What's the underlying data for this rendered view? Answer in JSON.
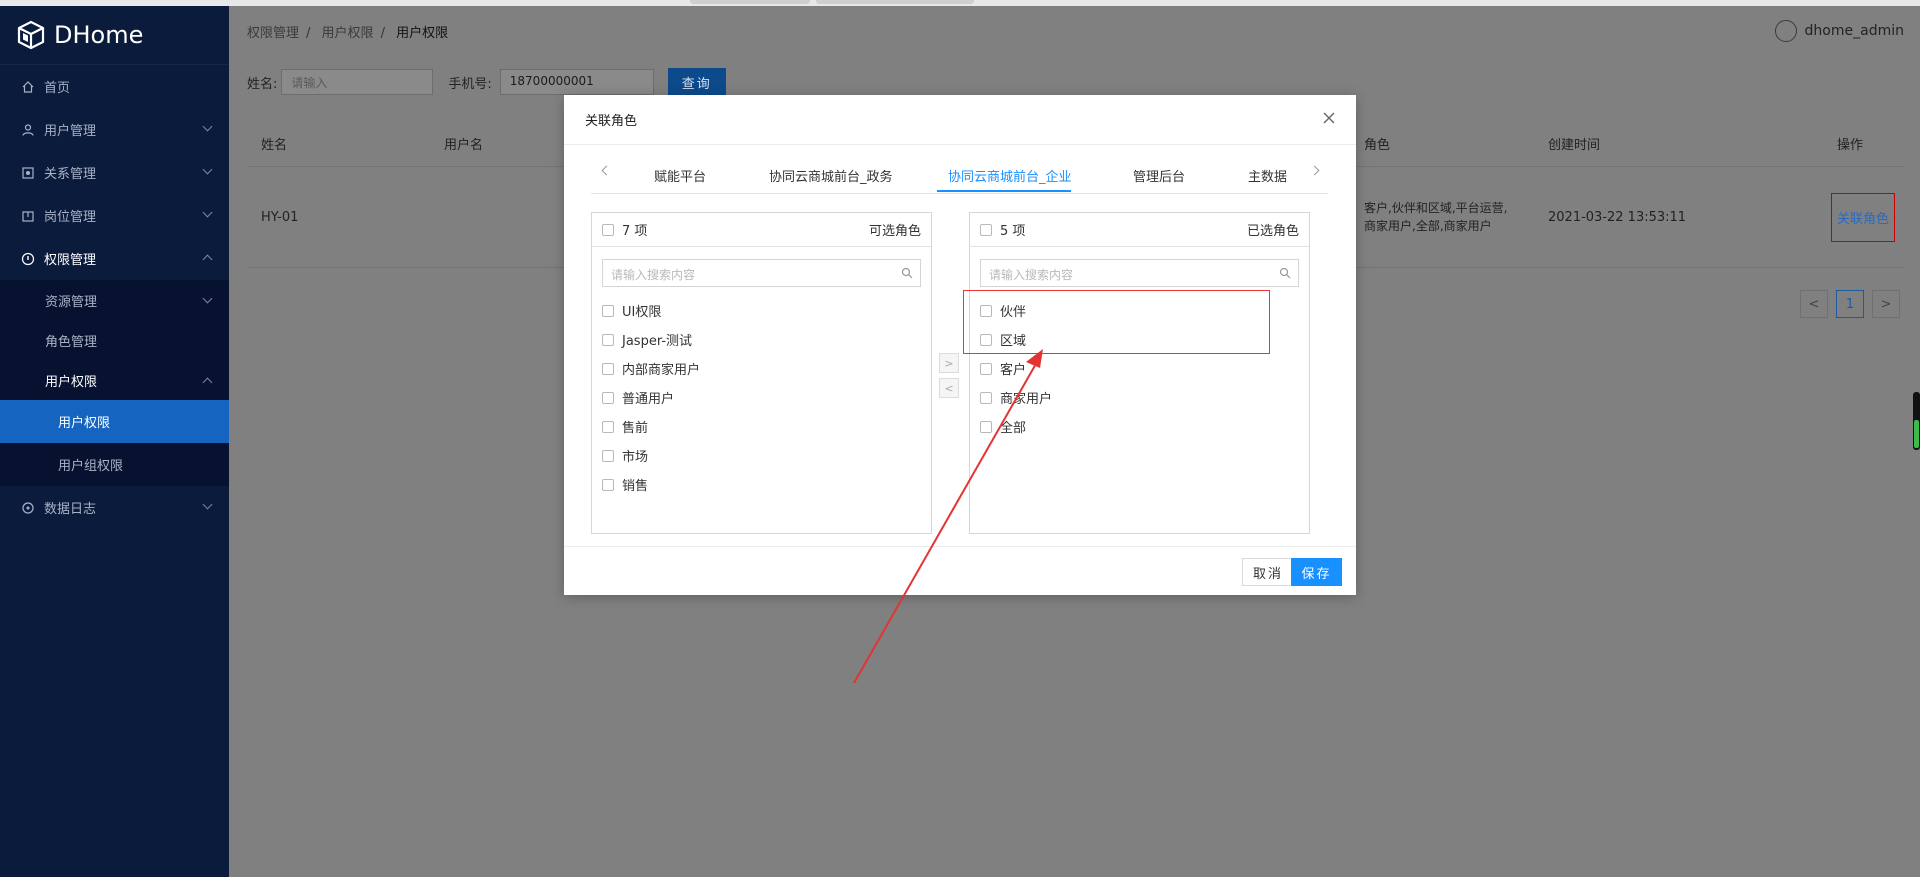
{
  "brand": {
    "name": "DHome",
    "icon": "cube-logo-icon"
  },
  "sidebar": {
    "items": [
      {
        "label": "首页",
        "icon": "home-icon"
      },
      {
        "label": "用户管理",
        "icon": "user-icon"
      },
      {
        "label": "关系管理",
        "icon": "relation-icon"
      },
      {
        "label": "岗位管理",
        "icon": "post-icon"
      },
      {
        "label": "权限管理",
        "icon": "shield-icon"
      },
      {
        "label": "资源管理"
      },
      {
        "label": "角色管理"
      },
      {
        "label": "用户权限"
      },
      {
        "label": "用户权限"
      },
      {
        "label": "用户组权限"
      },
      {
        "label": "数据日志",
        "icon": "log-icon"
      }
    ]
  },
  "breadcrumb": [
    "权限管理",
    "用户权限",
    "用户权限"
  ],
  "breadcrumb_sep": "/",
  "user": {
    "name": "dhome_admin"
  },
  "filter": {
    "name_label": "姓名:",
    "name_placeholder": "请输入",
    "phone_label": "手机号:",
    "phone_value": "18700000001",
    "query_label": "查询"
  },
  "table": {
    "headers": [
      "姓名",
      "用户名",
      "角色",
      "创建时间",
      "操作"
    ],
    "row": {
      "name": "HY-01",
      "roles_line1": "客户,伙伴和区域,平台运营,",
      "roles_line2": "商家用户,全部,商家用户",
      "created": "2021-03-22 13:53:11",
      "action": "关联角色"
    }
  },
  "pager": {
    "prev": "<",
    "page": "1",
    "next": ">"
  },
  "modal": {
    "title": "关联角色",
    "tabs": [
      "赋能平台",
      "协同云商城前台_政务",
      "协同云商城前台_企业",
      "管理后台",
      "主数据"
    ],
    "active_tab": "协同云商城前台_企业",
    "left": {
      "count": "7 项",
      "title": "可选角色",
      "search_placeholder": "请输入搜索内容",
      "items": [
        "UI权限",
        "Jasper-测试",
        "内部商家用户",
        "普通用户",
        "售前",
        "市场",
        "销售"
      ]
    },
    "right": {
      "count": "5 项",
      "title": "已选角色",
      "search_placeholder": "请输入搜索内容",
      "items": [
        "伙伴",
        "区域",
        "客户",
        "商家用户",
        "全部"
      ]
    },
    "move_right": ">",
    "move_left": "<",
    "cancel": "取消",
    "save": "保存"
  },
  "colors": {
    "accent": "#1890ff",
    "sidebar": "#0b1b3c",
    "annotation": "#e33333"
  }
}
